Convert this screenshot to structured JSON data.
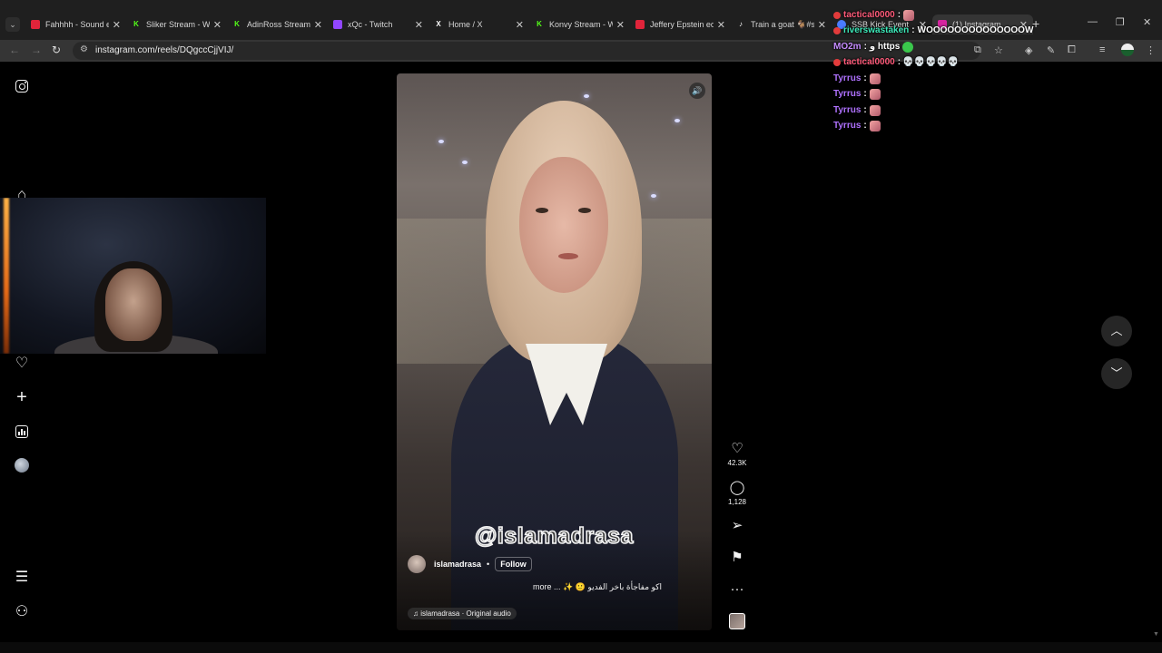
{
  "browser": {
    "tabs": [
      {
        "title": "Fahhhh - Sound e",
        "color": "#e0243a"
      },
      {
        "title": "Sliker Stream - W",
        "color": "#53fc18"
      },
      {
        "title": "AdinRoss Stream",
        "color": "#53fc18"
      },
      {
        "title": "xQc - Twitch",
        "color": "#9146ff"
      },
      {
        "title": "Home / X",
        "color": "#ffffff"
      },
      {
        "title": "Konvy Stream - W",
        "color": "#53fc18"
      },
      {
        "title": "Jeffery Epstein ed",
        "color": "#e0243a"
      },
      {
        "title": "Train a goat 🐐#s",
        "color": "#ffffff"
      },
      {
        "title": "SSB Kick Event",
        "color": "#4a7cff"
      },
      {
        "title": "(1) Instagram",
        "color": "#d6249f"
      }
    ],
    "url": "instagram.com/reels/DQgccCjjVIJ/"
  },
  "reel": {
    "username": "islamadrasa",
    "follow_label": "Follow",
    "watermark": "@islamadrasa",
    "caption": "more ... ✨ 🙂 اكو مفاجأة باخر الفديو",
    "audio": "islamadrasa · Original audio",
    "likes": "42.3K",
    "comments": "1,128"
  },
  "chat": [
    {
      "user": "tactical0000",
      "user_color": "#ff5b7a",
      "msg": "",
      "emote": "pink",
      "badge": true
    },
    {
      "user": "riverswastaken",
      "user_color": "#3ce8b8",
      "msg": "WOOOOOOOOOOOOOOW",
      "emote": "",
      "badge": true
    },
    {
      "user": "MO2m",
      "user_color": "#c58cff",
      "msg": "و https",
      "emote": "green",
      "badge": false
    },
    {
      "user": "tactical0000",
      "user_color": "#ff5b7a",
      "msg": "💀💀💀💀💀",
      "emote": "",
      "badge": true
    },
    {
      "user": "Tyrrus",
      "user_color": "#b072ff",
      "msg": "",
      "emote": "pink",
      "badge": false
    },
    {
      "user": "Tyrrus",
      "user_color": "#b072ff",
      "msg": "",
      "emote": "pink",
      "badge": false
    },
    {
      "user": "Tyrrus",
      "user_color": "#b072ff",
      "msg": "",
      "emote": "pink",
      "badge": false
    },
    {
      "user": "Tyrrus",
      "user_color": "#b072ff",
      "msg": "",
      "emote": "pink",
      "badge": false
    }
  ]
}
